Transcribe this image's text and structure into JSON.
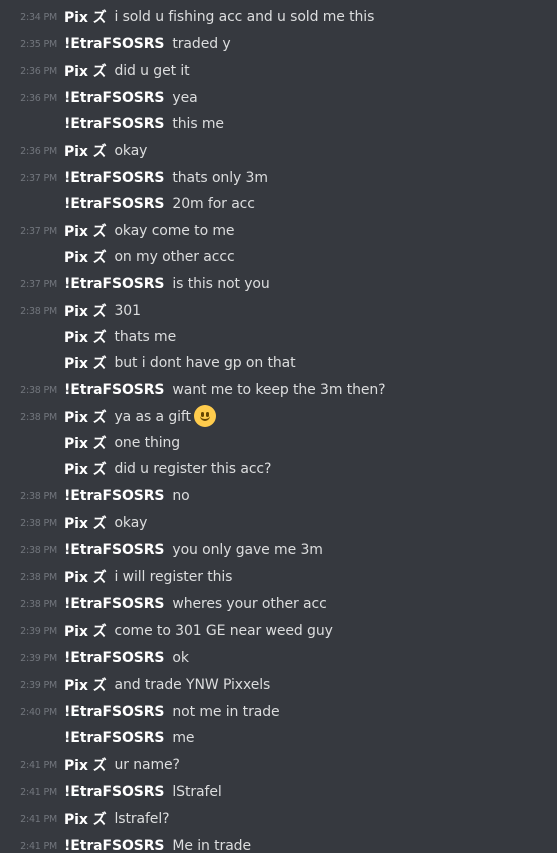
{
  "messages": [
    {
      "time": "2:34 PM",
      "author": "Pix ズ",
      "text": "i sold u fishing acc and u sold me this"
    },
    {
      "time": "2:35 PM",
      "author": "!EtraFSOSRS",
      "text": "traded y"
    },
    {
      "time": "2:36 PM",
      "author": "Pix ズ",
      "text": "did u get it"
    },
    {
      "time": "2:36 PM",
      "author": "!EtraFSOSRS",
      "text": "yea"
    },
    {
      "time": "",
      "author": "!EtraFSOSRS",
      "text": "this me"
    },
    {
      "time": "2:36 PM",
      "author": "Pix ズ",
      "text": "okay"
    },
    {
      "time": "2:37 PM",
      "author": "!EtraFSOSRS",
      "text": "thats only 3m"
    },
    {
      "time": "",
      "author": "!EtraFSOSRS",
      "text": "20m for acc"
    },
    {
      "time": "2:37 PM",
      "author": "Pix ズ",
      "text": "okay come to me"
    },
    {
      "time": "",
      "author": "Pix ズ",
      "text": "on my other accc"
    },
    {
      "time": "2:37 PM",
      "author": "!EtraFSOSRS",
      "text": "is this not you"
    },
    {
      "time": "2:38 PM",
      "author": "Pix ズ",
      "text": "301"
    },
    {
      "time": "",
      "author": "Pix ズ",
      "text": "thats me"
    },
    {
      "time": "",
      "author": "Pix ズ",
      "text": "but i dont have gp on that"
    },
    {
      "time": "2:38 PM",
      "author": "!EtraFSOSRS",
      "text": "want me to keep the 3m then?"
    },
    {
      "time": "2:38 PM",
      "author": "Pix ズ",
      "text": "ya as a gift",
      "emoji": "slightly-smiling-face"
    },
    {
      "time": "",
      "author": "Pix ズ",
      "text": "one thing"
    },
    {
      "time": "",
      "author": "Pix ズ",
      "text": "did u register this acc?"
    },
    {
      "time": "2:38 PM",
      "author": "!EtraFSOSRS",
      "text": "no"
    },
    {
      "time": "2:38 PM",
      "author": "Pix ズ",
      "text": "okay"
    },
    {
      "time": "2:38 PM",
      "author": "!EtraFSOSRS",
      "text": "you only gave me 3m"
    },
    {
      "time": "2:38 PM",
      "author": "Pix ズ",
      "text": "i will register this"
    },
    {
      "time": "2:38 PM",
      "author": "!EtraFSOSRS",
      "text": "wheres your other acc"
    },
    {
      "time": "2:39 PM",
      "author": "Pix ズ",
      "text": "come to 301 GE near weed guy"
    },
    {
      "time": "2:39 PM",
      "author": "!EtraFSOSRS",
      "text": "ok"
    },
    {
      "time": "2:39 PM",
      "author": "Pix ズ",
      "text": "and trade YNW Pixxels"
    },
    {
      "time": "2:40 PM",
      "author": "!EtraFSOSRS",
      "text": "not me in trade"
    },
    {
      "time": "",
      "author": "!EtraFSOSRS",
      "text": "me"
    },
    {
      "time": "2:41 PM",
      "author": "Pix ズ",
      "text": "ur name?"
    },
    {
      "time": "2:41 PM",
      "author": "!EtraFSOSRS",
      "text": "lStrafel"
    },
    {
      "time": "2:41 PM",
      "author": "Pix ズ",
      "text": "lstrafel?"
    },
    {
      "time": "2:41 PM",
      "author": "!EtraFSOSRS",
      "text": "Me in trade"
    }
  ]
}
